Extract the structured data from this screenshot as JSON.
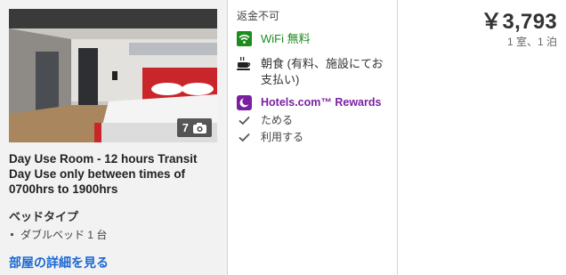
{
  "room": {
    "photo_count": "7",
    "title": "Day Use Room - 12 hours Transit Day Use only between times of 0700hrs to 1900hrs",
    "bed_type_heading": "ベッドタイプ",
    "bed_type_item": "ダブルベッド 1 台",
    "details_link": "部屋の詳細を見る"
  },
  "features": {
    "refund_policy": "返金不可",
    "wifi": "WiFi 無料",
    "breakfast": "朝食 (有料、施設にてお支払い)",
    "rewards_title": "Hotels.com™ Rewards",
    "rewards_earn": "ためる",
    "rewards_use": "利用する",
    "icons": [
      "wifi-icon",
      "coffee-cup-icon",
      "moon-rewards-icon",
      "checkmark-icon",
      "checkmark-icon"
    ]
  },
  "pricing": {
    "price": "￥3,793",
    "per_unit": "1 室、1 泊"
  },
  "colors": {
    "link": "#1967d2",
    "wifi_green": "#1c8c1c",
    "rewards_purple": "#7b1fa2"
  }
}
